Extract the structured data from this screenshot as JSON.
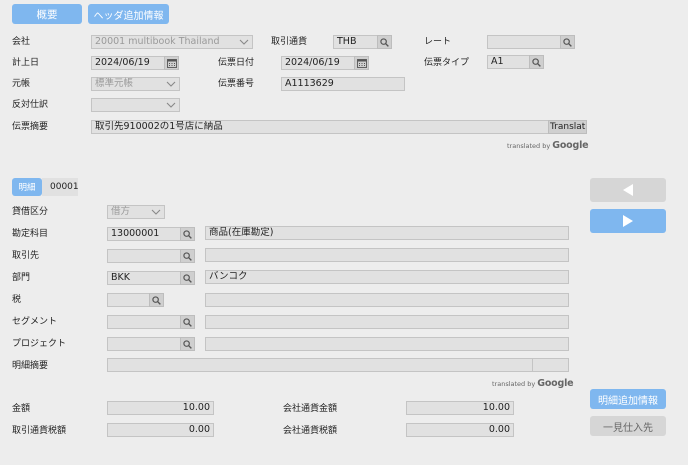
{
  "header": {
    "tab_overview": "概要",
    "tab_header_extra": "ヘッダ追加情報",
    "company_label": "会社",
    "company_value": "20001 multibook Thailand",
    "currency_label": "取引通貨",
    "currency_value": "THB",
    "rate_label": "レート",
    "rate_value": "",
    "posting_date_label": "計上日",
    "posting_date_value": "2024/06/19",
    "voucher_date_label": "伝票日付",
    "voucher_date_value": "2024/06/19",
    "voucher_type_label": "伝票タイプ",
    "voucher_type_value": "A1",
    "ledger_label": "元帳",
    "ledger_value": "標準元帳",
    "voucher_no_label": "伝票番号",
    "voucher_no_value": "A1113629",
    "reverse_label": "反対仕訳",
    "reverse_value": "",
    "memo_label": "伝票摘要",
    "memo_value": "取引先910002の1号店に納品",
    "translate_label": "Translat",
    "translated_by": "translated by",
    "google": "Google"
  },
  "detail": {
    "tab_label": "明細",
    "line_no": "00001",
    "dc_label": "貸借区分",
    "dc_value": "借方",
    "account_label": "勘定科目",
    "account_code": "13000001",
    "account_name": "商品(在庫勘定)",
    "partner_label": "取引先",
    "partner_code": "",
    "partner_name": "",
    "dept_label": "部門",
    "dept_code": "BKK",
    "dept_name": "バンコク",
    "tax_label": "税",
    "tax_code": "",
    "tax_name": "",
    "segment_label": "セグメント",
    "segment_code": "",
    "segment_name": "",
    "project_label": "プロジェクト",
    "project_code": "",
    "project_name": "",
    "line_memo_label": "明細摘要",
    "line_memo_value": "",
    "translated_by": "translated by",
    "google": "Google",
    "amount_label": "金額",
    "amount_value": "10.00",
    "company_amount_label": "会社通貨金額",
    "company_amount_value": "10.00",
    "tax_amount_label": "取引通貨税額",
    "tax_amount_value": "0.00",
    "company_tax_label": "会社通貨税額",
    "company_tax_value": "0.00",
    "btn_detail_extra": "明細追加情報",
    "btn_bulk_entry": "一見仕入先"
  },
  "colors": {
    "accent": "#7fb7ef",
    "background": "#ededed",
    "field": "#e1e1e1"
  }
}
